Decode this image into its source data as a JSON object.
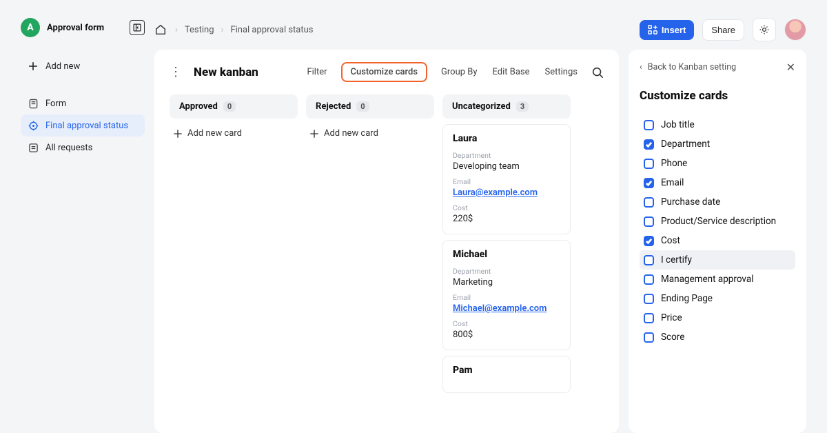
{
  "brand": {
    "initial": "A",
    "title": "Approval form"
  },
  "sidebar": {
    "add_new": "Add new",
    "items": [
      {
        "label": "Form"
      },
      {
        "label": "Final approval status"
      },
      {
        "label": "All requests"
      }
    ]
  },
  "breadcrumb": {
    "a": "Testing",
    "b": "Final approval status"
  },
  "topbar": {
    "insert": "Insert",
    "share": "Share"
  },
  "kanban": {
    "title": "New kanban",
    "actions": {
      "filter": "Filter",
      "customize": "Customize cards",
      "group_by": "Group By",
      "edit_base": "Edit Base",
      "settings": "Settings"
    },
    "add_card_label": "Add new card",
    "columns": [
      {
        "name": "Approved",
        "count": "0",
        "cards": []
      },
      {
        "name": "Rejected",
        "count": "0",
        "cards": []
      },
      {
        "name": "Uncategorized",
        "count": "3",
        "cards": [
          {
            "name": "Laura",
            "dept": "Developing team",
            "email": "Laura@example.com",
            "cost": "220$"
          },
          {
            "name": "Michael",
            "dept": "Marketing",
            "email": "Michael@example.com",
            "cost": "800$"
          },
          {
            "name": "Pam"
          }
        ]
      }
    ],
    "field_labels": {
      "dept": "Department",
      "email": "Email",
      "cost": "Cost"
    }
  },
  "settings_panel": {
    "back": "Back to Kanban setting",
    "title": "Customize cards",
    "options": [
      {
        "label": "Job title",
        "checked": false
      },
      {
        "label": "Department",
        "checked": true
      },
      {
        "label": "Phone",
        "checked": false
      },
      {
        "label": "Email",
        "checked": true
      },
      {
        "label": "Purchase date",
        "checked": false
      },
      {
        "label": "Product/Service description",
        "checked": false
      },
      {
        "label": "Cost",
        "checked": true
      },
      {
        "label": "I certify",
        "checked": false,
        "hover": true
      },
      {
        "label": "Management approval",
        "checked": false
      },
      {
        "label": "Ending Page",
        "checked": false
      },
      {
        "label": "Price",
        "checked": false
      },
      {
        "label": "Score",
        "checked": false
      }
    ]
  }
}
